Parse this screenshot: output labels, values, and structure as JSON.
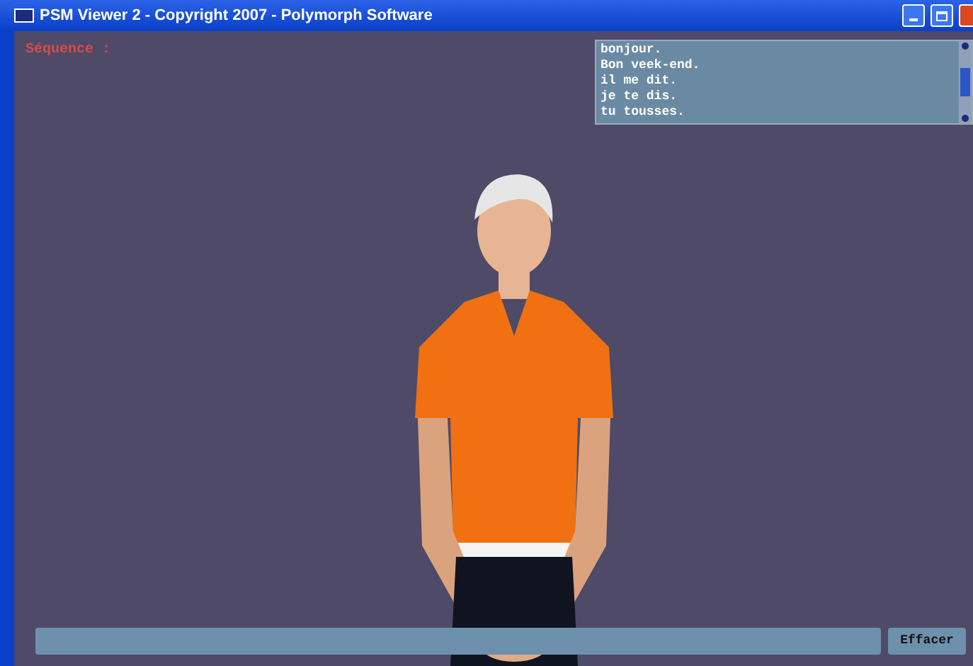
{
  "window": {
    "title": "PSM Viewer 2 - Copyright 2007 - Polymorph Software"
  },
  "sequence_label": "Séquence :",
  "phrase_list": [
    "bonjour.",
    "Bon veek-end.",
    "il me dit.",
    "je te dis.",
    "tu tousses."
  ],
  "clear_button": "Effacer"
}
